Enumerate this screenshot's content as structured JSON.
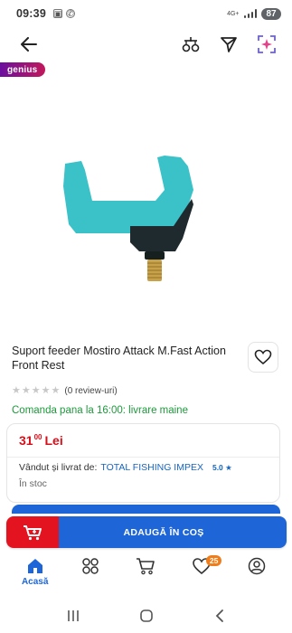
{
  "status_bar": {
    "time": "09:39",
    "network": "4G+",
    "battery": "87"
  },
  "badge": {
    "label": "genius"
  },
  "product": {
    "title": "Suport feeder Mostiro Attack M.Fast Action Front Rest",
    "reviews": "(0 review-uri)",
    "rating_stars": 0,
    "delivery": "Comanda pana la 16:00: livrare maine"
  },
  "price": {
    "integer": "31",
    "decimals": "00",
    "currency": "Lei"
  },
  "seller": {
    "label": "Vândut și livrat de:",
    "name": "TOTAL FISHING IMPEX",
    "rating": "5.0 ★"
  },
  "stock": "În stoc",
  "cart": {
    "button_label": "ADAUGĂ ÎN COȘ"
  },
  "nav": {
    "home_label": "Acasă",
    "favorites_badge": "25"
  },
  "colors": {
    "accent_blue": "#1e66d8",
    "cta_red": "#e3141f",
    "price_red": "#d6101b",
    "delivery_green": "#1b9a3a",
    "product_teal": "#3ac2c8",
    "badge_orange": "#f07d1a"
  },
  "icons": {
    "back": "arrow-left-icon",
    "compare": "compare-icon",
    "share": "send-icon",
    "ai": "sparkle-icon",
    "favorite": "heart-icon",
    "cart": "cart-icon",
    "home": "home-icon",
    "categories": "grid-icon",
    "nav_cart": "cart-icon",
    "nav_favorites": "heart-icon",
    "account": "user-icon"
  }
}
